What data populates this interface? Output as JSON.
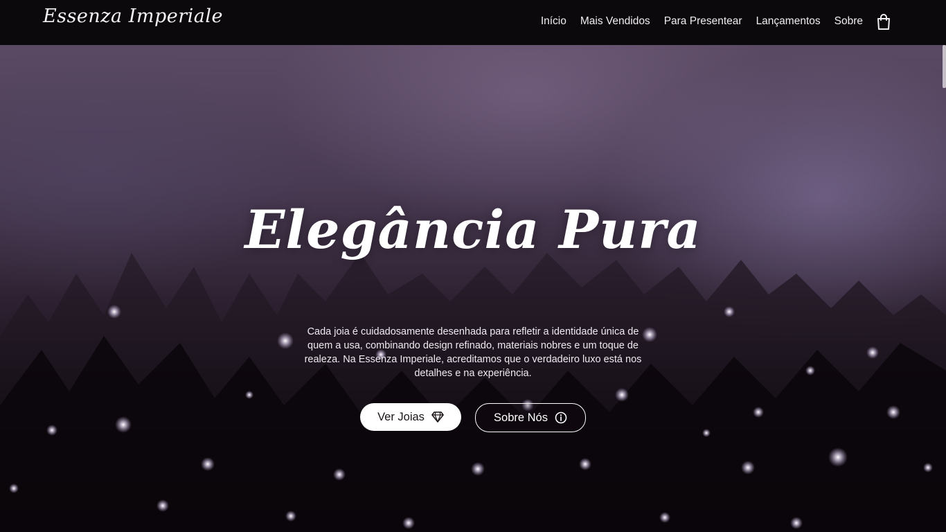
{
  "brand": {
    "logo_text": "Essenza Imperiale"
  },
  "nav": {
    "items": [
      {
        "label": "Início"
      },
      {
        "label": "Mais Vendidos"
      },
      {
        "label": "Para Presentear"
      },
      {
        "label": "Lançamentos"
      },
      {
        "label": "Sobre"
      }
    ],
    "cart_icon": "shopping-bag-icon"
  },
  "hero": {
    "title": "Elegância Pura",
    "description": "Cada joia é cuidadosamente desenhada para refletir a identidade única de quem a usa, combinando design refinado, materiais nobres e um toque de realeza. Na Essenza Imperiale, acreditamos que o verdadeiro luxo está nos detalhes e na experiência.",
    "primary_button": {
      "label": "Ver Joias",
      "icon": "diamond-icon"
    },
    "secondary_button": {
      "label": "Sobre Nós",
      "icon": "info-circle-icon"
    }
  },
  "colors": {
    "nav_background": "#0b090b",
    "hero_top": "#5b4a63",
    "hero_bottom": "#0b070b",
    "text": "#ffffff"
  }
}
